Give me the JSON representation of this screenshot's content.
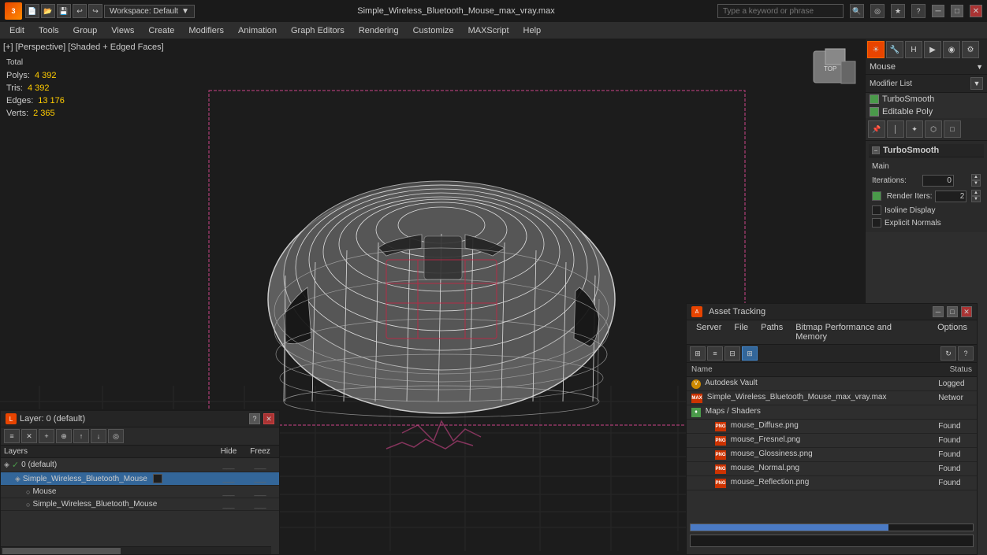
{
  "titlebar": {
    "app_name": "3ds Max",
    "filename": "Simple_Wireless_Bluetooth_Mouse_max_vray.max",
    "workspace_label": "Workspace: Default",
    "search_placeholder": "Type a keyword or phrase",
    "min_btn": "─",
    "max_btn": "□",
    "close_btn": "✕"
  },
  "menubar": {
    "items": [
      "Edit",
      "Tools",
      "Group",
      "Views",
      "Create",
      "Modifiers",
      "Animation",
      "Graph Editors",
      "Rendering",
      "Customize",
      "MAXScript",
      "Help"
    ]
  },
  "viewport": {
    "header": "[+] [Perspective] [Shaded + Edged Faces]",
    "stats": {
      "polys_label": "Polys:",
      "polys_value": "4 392",
      "tris_label": "Tris:",
      "tris_value": "4 392",
      "edges_label": "Edges:",
      "edges_value": "13 176",
      "verts_label": "Verts:",
      "verts_value": "2 365",
      "total_label": "Total"
    }
  },
  "right_panel": {
    "object_name": "Mouse",
    "modifier_list_label": "Modifier List",
    "modifiers": [
      {
        "name": "TurboSmooth",
        "checked": true,
        "selected": false
      },
      {
        "name": "Editable Poly",
        "checked": true,
        "selected": false
      }
    ],
    "turbosmooth": {
      "collapse_symbol": "−",
      "header_label": "TurboSmooth",
      "main_label": "Main",
      "iterations_label": "Iterations:",
      "iterations_value": "0",
      "render_iters_label": "Render Iters:",
      "render_iters_value": "2",
      "isoline_display_label": "Isoline Display",
      "explicit_normals_label": "Explicit Normals"
    }
  },
  "layers_panel": {
    "title": "Layer: 0 (default)",
    "close_btn": "✕",
    "columns": {
      "name": "Layers",
      "hide": "Hide",
      "freeze": "Freez"
    },
    "layers": [
      {
        "indent": 0,
        "type": "layer",
        "icon": "◈",
        "name": "0 (default)",
        "checkmark": true,
        "selected": false
      },
      {
        "indent": 1,
        "type": "layer",
        "icon": "◈",
        "name": "Simple_Wireless_Bluetooth_Mouse",
        "checkmark": false,
        "selected": true,
        "has_box": true
      },
      {
        "indent": 2,
        "type": "object",
        "icon": "○",
        "name": "Mouse",
        "checkmark": false,
        "selected": false
      },
      {
        "indent": 2,
        "type": "object",
        "icon": "○",
        "name": "Simple_Wireless_Bluetooth_Mouse",
        "checkmark": false,
        "selected": false
      }
    ]
  },
  "asset_panel": {
    "title": "Asset Tracking",
    "menu_items": [
      "Server",
      "File",
      "Paths",
      "Bitmap Performance and Memory",
      "Options"
    ],
    "table": {
      "col_name": "Name",
      "col_status": "Status",
      "rows": [
        {
          "indent": 0,
          "type": "vault",
          "name": "Autodesk Vault",
          "status": "Logged"
        },
        {
          "indent": 1,
          "type": "file",
          "name": "Simple_Wireless_Bluetooth_Mouse_max_vray.max",
          "status": "Networ"
        },
        {
          "indent": 2,
          "type": "folder",
          "name": "Maps / Shaders",
          "status": ""
        },
        {
          "indent": 3,
          "type": "png",
          "name": "mouse_Diffuse.png",
          "status": "Found"
        },
        {
          "indent": 3,
          "type": "png",
          "name": "mouse_Fresnel.png",
          "status": "Found"
        },
        {
          "indent": 3,
          "type": "png",
          "name": "mouse_Glossiness.png",
          "status": "Found"
        },
        {
          "indent": 3,
          "type": "png",
          "name": "mouse_Normal.png",
          "status": "Found"
        },
        {
          "indent": 3,
          "type": "png",
          "name": "mouse_Reflection.png",
          "status": "Found"
        }
      ]
    }
  }
}
